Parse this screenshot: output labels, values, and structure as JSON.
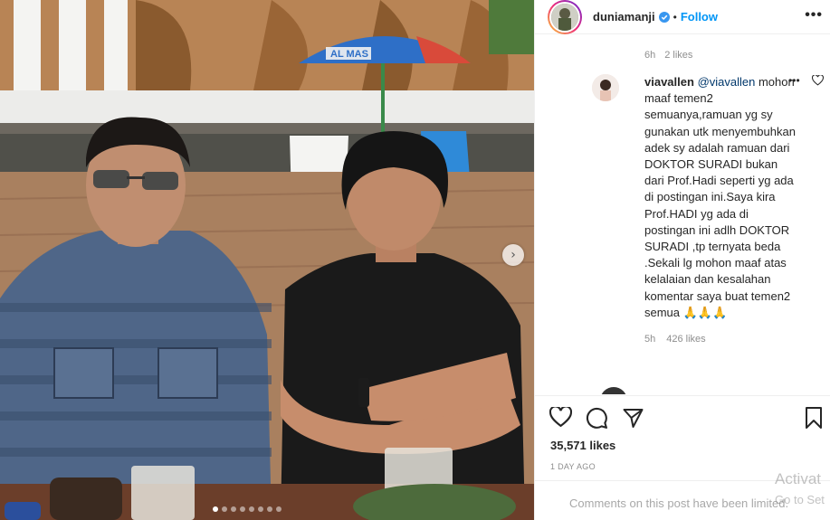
{
  "post": {
    "username": "duniamanji",
    "follow_label": "Follow",
    "separator": "•",
    "more_label": "•••"
  },
  "previous_comment": {
    "time": "6h",
    "likes": "2 likes"
  },
  "comment": {
    "username": "viavallen",
    "mention": "@viavallen",
    "text": "mohon maaf temen2 semuanya,ramuan yg sy gunakan utk menyembuhkan adek sy adalah ramuan dari DOKTOR SURADI bukan dari Prof.Hadi seperti yg ada di postingan ini.Saya kira Prof.HADI yg ada di postingan ini adlh DOKTOR SURADI ,tp ternyata beda .Sekali lg mohon maaf atas kelalaian dan kesalahan komentar saya buat temen2 semua 🙏🙏🙏",
    "time": "5h",
    "likes": "426 likes",
    "more_label": "•••"
  },
  "stats": {
    "likes": "35,571 likes",
    "date": "1 DAY AGO"
  },
  "add_comment": {
    "placeholder": "Comments on this post have been limited."
  },
  "os_watermark": {
    "line1": "Activat",
    "line2": "Go to Set"
  },
  "photo": {
    "umbrella_text": "AL MAS"
  },
  "icons": [
    "verified-badge-icon",
    "more-options-icon",
    "heart-icon",
    "comment-icon",
    "share-icon",
    "bookmark-icon",
    "next-arrow-icon",
    "comment-like-heart-icon"
  ],
  "colors": {
    "accent": "#0095f6",
    "secondary_text": "#8e8e8e",
    "mention": "#00376b"
  }
}
